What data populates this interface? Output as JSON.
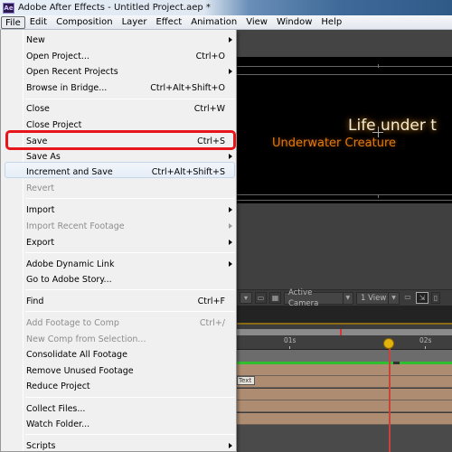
{
  "window": {
    "app_icon_label": "Ae",
    "title": "Adobe After Effects - Untitled Project.aep *"
  },
  "menubar": {
    "items": [
      "File",
      "Edit",
      "Composition",
      "Layer",
      "Effect",
      "Animation",
      "View",
      "Window",
      "Help"
    ],
    "active": "File"
  },
  "file_menu": {
    "items": [
      {
        "label": "New",
        "shortcut": "",
        "submenu": true,
        "disabled": false
      },
      {
        "label": "Open Project...",
        "shortcut": "Ctrl+O",
        "submenu": false,
        "disabled": false
      },
      {
        "label": "Open Recent Projects",
        "shortcut": "",
        "submenu": true,
        "disabled": false
      },
      {
        "label": "Browse in Bridge...",
        "shortcut": "Ctrl+Alt+Shift+O",
        "submenu": false,
        "disabled": false
      },
      {
        "label": "Close",
        "shortcut": "Ctrl+W",
        "submenu": false,
        "disabled": false
      },
      {
        "label": "Close Project",
        "shortcut": "",
        "submenu": false,
        "disabled": false
      },
      {
        "label": "Save",
        "shortcut": "Ctrl+S",
        "submenu": false,
        "disabled": false,
        "highlighted": true
      },
      {
        "label": "Save As",
        "shortcut": "",
        "submenu": true,
        "disabled": false
      },
      {
        "label": "Increment and Save",
        "shortcut": "Ctrl+Alt+Shift+S",
        "submenu": false,
        "disabled": false
      },
      {
        "label": "Revert",
        "shortcut": "",
        "submenu": false,
        "disabled": true
      },
      {
        "label": "Import",
        "shortcut": "",
        "submenu": true,
        "disabled": false
      },
      {
        "label": "Import Recent Footage",
        "shortcut": "",
        "submenu": true,
        "disabled": true
      },
      {
        "label": "Export",
        "shortcut": "",
        "submenu": true,
        "disabled": false
      },
      {
        "label": "Adobe Dynamic Link",
        "shortcut": "",
        "submenu": true,
        "disabled": false
      },
      {
        "label": "Go to Adobe Story...",
        "shortcut": "",
        "submenu": false,
        "disabled": false
      },
      {
        "label": "Find",
        "shortcut": "Ctrl+F",
        "submenu": false,
        "disabled": false
      },
      {
        "label": "Add Footage to Comp",
        "shortcut": "Ctrl+/",
        "submenu": false,
        "disabled": true
      },
      {
        "label": "New Comp from Selection...",
        "shortcut": "",
        "submenu": false,
        "disabled": true
      },
      {
        "label": "Consolidate All Footage",
        "shortcut": "",
        "submenu": false,
        "disabled": false
      },
      {
        "label": "Remove Unused Footage",
        "shortcut": "",
        "submenu": false,
        "disabled": false
      },
      {
        "label": "Reduce Project",
        "shortcut": "",
        "submenu": false,
        "disabled": false
      },
      {
        "label": "Collect Files...",
        "shortcut": "",
        "submenu": false,
        "disabled": false
      },
      {
        "label": "Watch Folder...",
        "shortcut": "",
        "submenu": false,
        "disabled": false
      },
      {
        "label": "Scripts",
        "shortcut": "",
        "submenu": true,
        "disabled": false
      }
    ]
  },
  "viewer": {
    "title_text": "Life under t",
    "subtitle_text": "Underwater Creature",
    "camera_dropdown": "Active Camera",
    "view_dropdown": "1 View"
  },
  "timeline": {
    "ruler_labels": [
      "01s",
      "02s"
    ],
    "layer_chip_label": "Text"
  },
  "colors": {
    "highlight_border": "#e8141c",
    "subtitle_orange": "#e07a10",
    "playhead": "#c8443a",
    "work_area_green": "#2fbf2f",
    "layer_bar": "#ad8c72"
  }
}
